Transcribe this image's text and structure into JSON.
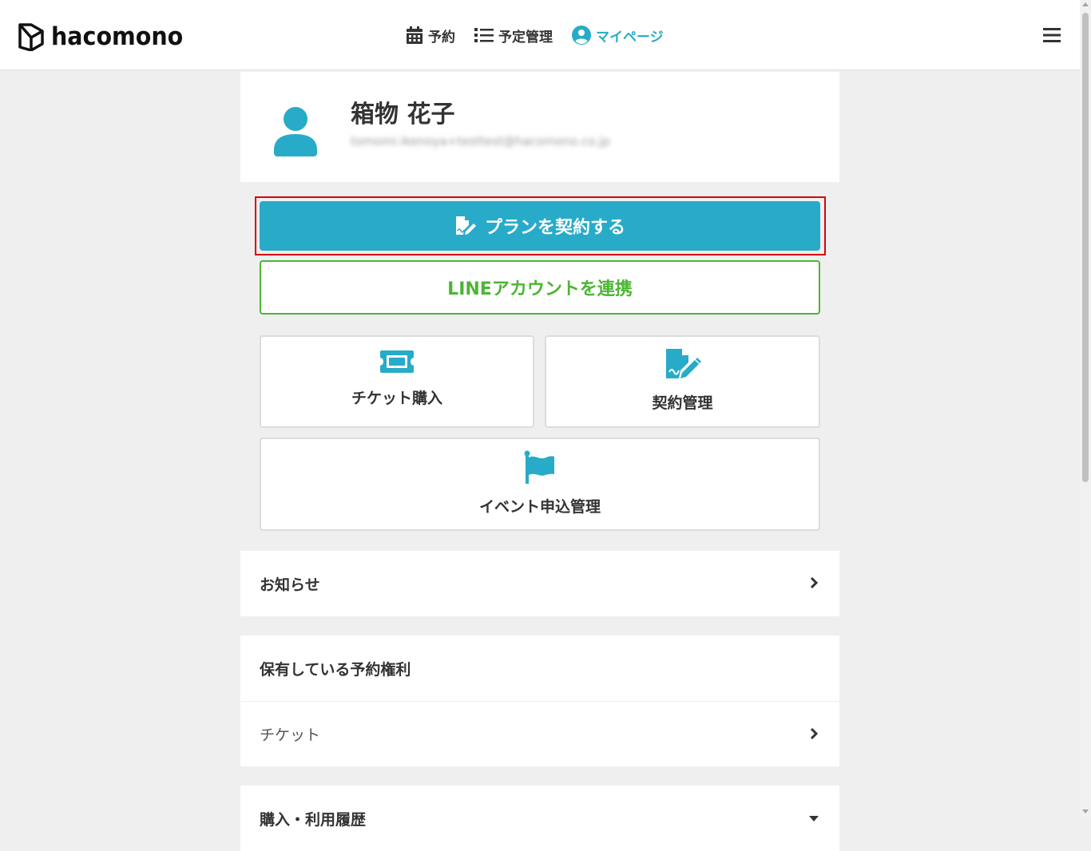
{
  "header": {
    "logo_text": "hacomono",
    "nav": [
      {
        "label": "予約",
        "icon": "calendar-icon"
      },
      {
        "label": "予定管理",
        "icon": "list-icon"
      },
      {
        "label": "マイページ",
        "icon": "user-circle-icon"
      }
    ],
    "menu_icon": "hamburger-icon"
  },
  "profile": {
    "name": "箱物 花子",
    "email": "tomomi.ikenoya+testtest@hacomono.co.jp"
  },
  "actions": {
    "plan_label": "プランを契約する",
    "line_label": "LINEアカウントを連携"
  },
  "tiles": [
    {
      "label": "チケット購入",
      "icon": "ticket-icon"
    },
    {
      "label": "契約管理",
      "icon": "contract-icon"
    },
    {
      "label": "イベント申込管理",
      "icon": "flag-icon"
    }
  ],
  "sections": {
    "news": {
      "label": "お知らせ"
    },
    "holdings": {
      "title": "保有している予約権利",
      "items": [
        "チケット"
      ]
    },
    "history": {
      "title": "購入・利用履歴"
    }
  },
  "colors": {
    "accent": "#27abc8",
    "line_green": "#4cb535",
    "highlight": "#d9040d",
    "background": "#efefef"
  }
}
